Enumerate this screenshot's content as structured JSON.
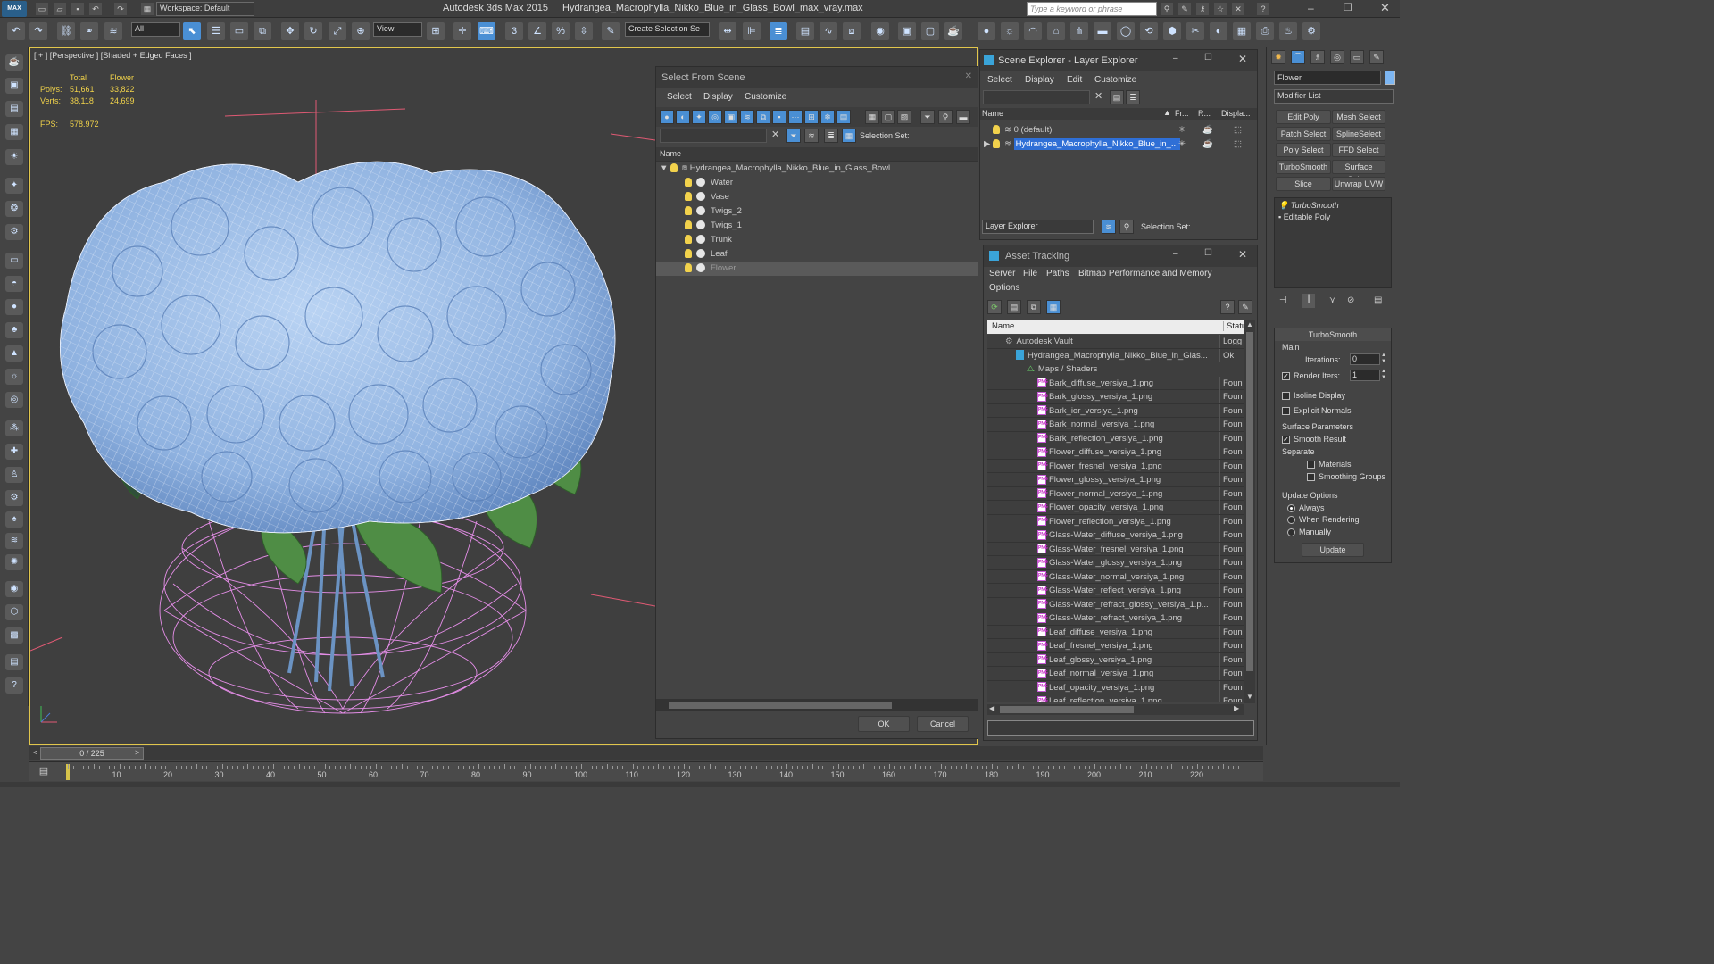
{
  "app": {
    "workspace": "Workspace: Default",
    "title_app": "Autodesk 3ds Max  2015",
    "title_file": "Hydrangea_Macrophylla_Nikko_Blue_in_Glass_Bowl_max_vray.max",
    "search_placeholder": "Type a keyword or phrase",
    "logo_text": "MAX"
  },
  "toolbar": {
    "filter_value": "All",
    "ref_coord": "View",
    "selection_set_placeholder": "Create Selection Se",
    "snap_label": "3",
    "angle_snap": "∠",
    "pct_snap": "%"
  },
  "viewport": {
    "label": "[ + ] [Perspective ] [Shaded + Edged Faces ]",
    "stats": {
      "col_total": "Total",
      "col_flower": "Flower",
      "polys_label": "Polys:",
      "polys_total": "51,661",
      "polys_flower": "33,822",
      "verts_label": "Verts:",
      "verts_total": "38,118",
      "verts_flower": "24,699",
      "fps_label": "FPS:",
      "fps_value": "578.972"
    }
  },
  "select_from_scene": {
    "title": "Select From Scene",
    "menus": [
      "Select",
      "Display",
      "Customize"
    ],
    "selection_set_label": "Selection Set:",
    "column_name": "Name",
    "root": "Hydrangea_Macrophylla_Nikko_Blue_in_Glass_Bowl",
    "items": [
      "Water",
      "Vase",
      "Twigs_2",
      "Twigs_1",
      "Trunk",
      "Leaf",
      "Flower"
    ],
    "ok": "OK",
    "cancel": "Cancel"
  },
  "scene_explorer": {
    "title": "Scene Explorer - Layer Explorer",
    "menus": [
      "Select",
      "Display",
      "Edit",
      "Customize"
    ],
    "columns": [
      "Name",
      "Fr...",
      "R...",
      "Displa..."
    ],
    "layers": [
      "0 (default)",
      "Hydrangea_Macrophylla_Nikko_Blue_in_..."
    ],
    "footer_combo": "Layer Explorer",
    "selection_set_label": "Selection Set:"
  },
  "asset_tracking": {
    "title": "Asset Tracking",
    "menus": [
      "Server",
      "File",
      "Paths",
      "Bitmap Performance and Memory",
      "Options"
    ],
    "columns": [
      "Name",
      "Statu"
    ],
    "vault": {
      "name": "Autodesk Vault",
      "status": "Logg"
    },
    "file": {
      "name": "Hydrangea_Macrophylla_Nikko_Blue_in_Glas...",
      "status": "Ok"
    },
    "maps_folder": "Maps / Shaders",
    "maps": [
      "Bark_diffuse_versiya_1.png",
      "Bark_glossy_versiya_1.png",
      "Bark_ior_versiya_1.png",
      "Bark_normal_versiya_1.png",
      "Bark_reflection_versiya_1.png",
      "Flower_diffuse_versiya_1.png",
      "Flower_fresnel_versiya_1.png",
      "Flower_glossy_versiya_1.png",
      "Flower_normal_versiya_1.png",
      "Flower_opacity_versiya_1.png",
      "Flower_reflection_versiya_1.png",
      "Glass-Water_diffuse_versiya_1.png",
      "Glass-Water_fresnel_versiya_1.png",
      "Glass-Water_glossy_versiya_1.png",
      "Glass-Water_normal_versiya_1.png",
      "Glass-Water_reflect_versiya_1.png",
      "Glass-Water_refract_glossy_versiya_1.p...",
      "Glass-Water_refract_versiya_1.png",
      "Leaf_diffuse_versiya_1.png",
      "Leaf_fresnel_versiya_1.png",
      "Leaf_glossy_versiya_1.png",
      "Leaf_normal_versiya_1.png",
      "Leaf_opacity_versiya_1.png",
      "Leaf_reflection_versiya_1.png"
    ],
    "map_status": "Foun"
  },
  "command_panel": {
    "object_name": "Flower",
    "modifier_list": "Modifier List",
    "buttons": [
      "Edit Poly",
      "Mesh Select",
      "Patch Select",
      "SplineSelect",
      "Poly Select",
      "FFD Select",
      "TurboSmooth",
      "Surface Select",
      "Slice",
      "Unwrap UVW"
    ],
    "stack": [
      "TurboSmooth",
      "Editable Poly"
    ],
    "rollout_title": "TurboSmooth",
    "main_group": "Main",
    "iterations_label": "Iterations:",
    "iterations_value": "0",
    "render_iters_label": "Render Iters:",
    "render_iters_value": "1",
    "isoline_label": "Isoline Display",
    "explicit_normals_label": "Explicit Normals",
    "surface_params_label": "Surface Parameters",
    "smooth_result_label": "Smooth Result",
    "separate_label": "Separate",
    "materials_label": "Materials",
    "smoothing_groups_label": "Smoothing Groups",
    "update_options_label": "Update Options",
    "always_label": "Always",
    "when_rendering_label": "When Rendering",
    "manually_label": "Manually",
    "update_button": "Update"
  },
  "timeline": {
    "frame_counter": "0 / 225",
    "ticks": [
      "10",
      "20",
      "30",
      "40",
      "50",
      "60",
      "70",
      "80",
      "90",
      "100",
      "110",
      "120",
      "130",
      "140",
      "150",
      "160",
      "170",
      "180",
      "190",
      "200",
      "210",
      "220"
    ]
  },
  "colors": {
    "viewport_border": "#e1c64c",
    "selection_blue": "#2f6fd6",
    "vase_wire": "#e58ee8",
    "petal_blue": "#9fc0e6",
    "leaf_green": "#4f8d45"
  }
}
